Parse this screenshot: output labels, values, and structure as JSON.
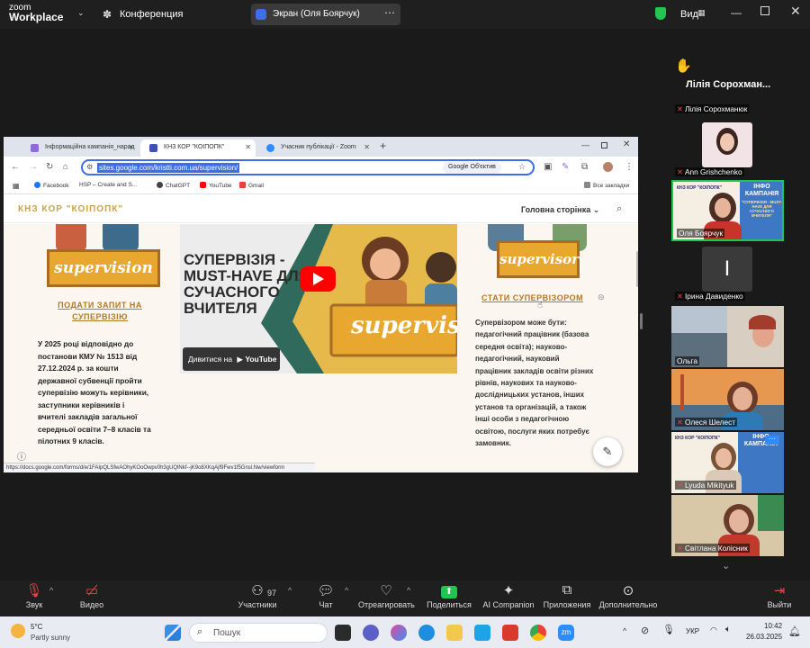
{
  "zoom": {
    "brand_top": "zoom",
    "brand_bottom": "Workplace",
    "meeting_label": "Конференция",
    "screen_share_label": "Экран (Оля Боярчук)",
    "view_label": "Вид"
  },
  "browser": {
    "tabs": [
      {
        "label": "Інформаційна кампанія_нарад",
        "active": false
      },
      {
        "label": "КНЗ КОР \"КОІПОПК\"",
        "active": true
      },
      {
        "label": "Учасник публікації - Zoom",
        "active": false
      }
    ],
    "url": "sites.google.com/kristti.com.ua/supervision/",
    "lens_label": "Google Об'єктив",
    "bookmarks": [
      "Facebook",
      "HSP – Create and S...",
      "ChatGPT",
      "YouTube",
      "Gmail"
    ],
    "all_bookmarks": "Все закладки",
    "status_url": "https://docs.google.com/forms/d/e/1FAIpQLSfwAOhyKOoOwpv0h3gUQlNkf--jK9o8XKqAjf9Fwv1f5Gnsl.Nw/viewform"
  },
  "site": {
    "logo": "КНЗ КОР \"КОІПОПК\"",
    "nav": "Головна сторінка",
    "left_sign": "supervision",
    "left_link": [
      "ПОДАТИ ЗАПИТ НА",
      "СУПЕРВІЗІЮ"
    ],
    "left_para": [
      "У 2025 році відповідно до",
      "постанови КМУ № 1513 від",
      "27.12.2024 р. за кошти",
      "державної субвенції пройти",
      "супервізію можуть керівники,",
      "заступники керівників і",
      "вчителі закладів загальної",
      "середньої освіти 7–8 класів та",
      "пілотних 9 класів."
    ],
    "video_title": [
      "СУПЕРВІЗІЯ -",
      "MUST-HAVE ДЛЯ",
      "СУЧАСНОГО",
      "ВЧИТЕЛЯ"
    ],
    "video_sign": "supervision",
    "watch_on": "Дивитися на",
    "youtube": "YouTube",
    "right_sign": "supervisor",
    "right_link": "СТАТИ СУПЕРВІЗОРОМ",
    "right_para": [
      "Супервізором може бути:",
      "педагогічний працівник (базова",
      "середня освіта); науково-",
      "педагогічний, науковий",
      "працівник закладів освіти різних",
      "рівнів, наукових та науково-",
      "дослідницьких установ, інших",
      "установ та організацій, а також",
      "інші особи з педагогічною",
      "освітою, послуги яких потребує",
      "замовник."
    ]
  },
  "participants": {
    "header_name": "Лілія Сорохман...",
    "list": [
      {
        "name": "Лілія Сорохманюк"
      },
      {
        "name": "Ann Grishchenko"
      },
      {
        "name": "Оля Боярчук"
      },
      {
        "name": "Ірина Давиденко",
        "initial": "I"
      },
      {
        "name": "Ольга"
      },
      {
        "name": "Олеся Шелест"
      },
      {
        "name": "Lyuda Mikityuk"
      },
      {
        "name": "Світлана Колісник"
      }
    ],
    "tile_banner": [
      "ІНФО",
      "КАМПАНІЯ",
      "\"СУПЕРВІЗІЯ - MUST-HAVE ДЛЯ СУЧАСНОГО ВЧИТЕЛЯ\""
    ],
    "tile_logo": "КНЗ КОР \"КОІПОПК\""
  },
  "toolbar": {
    "items": [
      {
        "label": "Звук",
        "icon": "mic-muted-icon"
      },
      {
        "label": "Видео",
        "icon": "video-off-icon"
      },
      {
        "label": "Участники",
        "icon": "participants-icon",
        "count": "97"
      },
      {
        "label": "Чат",
        "icon": "chat-icon"
      },
      {
        "label": "Отреагировать",
        "icon": "heart-icon"
      },
      {
        "label": "Поделиться",
        "icon": "share-icon"
      },
      {
        "label": "AI Companion",
        "icon": "sparkle-icon"
      },
      {
        "label": "Приложения",
        "icon": "apps-icon"
      },
      {
        "label": "Дополнительно",
        "icon": "more-icon"
      },
      {
        "label": "Выйти",
        "icon": "exit-icon"
      }
    ]
  },
  "taskbar": {
    "weather_temp": "5°C",
    "weather_desc": "Partly sunny",
    "search_placeholder": "Пошук",
    "lang": "УКР",
    "time": "10:42",
    "date": "26.03.2025"
  },
  "colors": {
    "accent_blue": "#3d6ee8",
    "zoom_green": "#23c552",
    "gold": "#c9a44a",
    "sign_orange": "#e8a72f",
    "mute_red": "#e04848"
  }
}
